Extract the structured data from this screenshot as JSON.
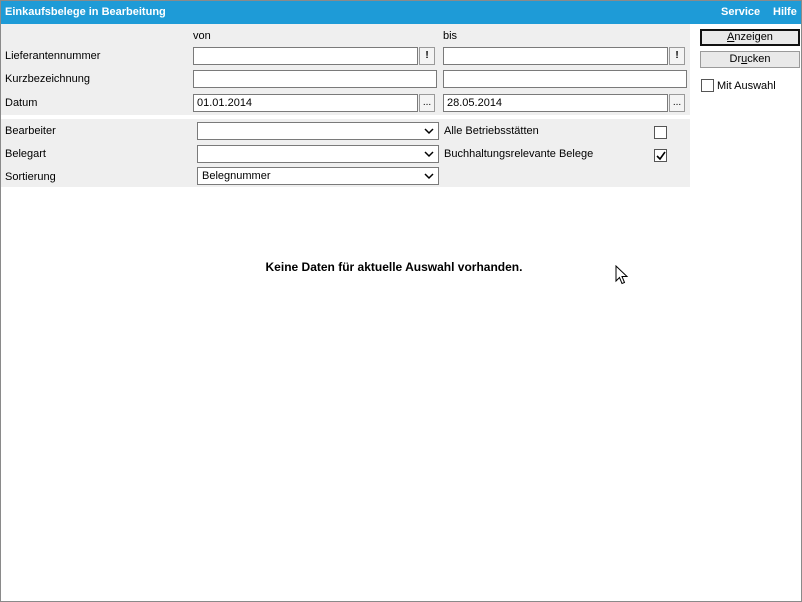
{
  "window": {
    "title": "Einkaufsbelege in Bearbeitung",
    "menu": [
      "Service",
      "Hilfe"
    ]
  },
  "columns": {
    "from": "von",
    "to": "bis"
  },
  "range_fields": {
    "supplier_number": {
      "label": "Lieferantennummer",
      "from_value": "",
      "to_value": "",
      "lookup_glyph": "!"
    },
    "short_name": {
      "label": "Kurzbezeichnung",
      "from_value": "",
      "to_value": ""
    },
    "date": {
      "label": "Datum",
      "from_value": "01.01.2014",
      "to_value": "28.05.2014",
      "picker_glyph": "..."
    }
  },
  "filters": {
    "editor": {
      "label": "Bearbeiter",
      "value": ""
    },
    "document_type": {
      "label": "Belegart",
      "value": ""
    },
    "sorting": {
      "label": "Sortierung",
      "value": "Belegnummer"
    },
    "all_sites": {
      "label": "Alle Betriebsstätten",
      "checked": false
    },
    "accounting_relevant": {
      "label": "Buchhaltungsrelevante Belege",
      "checked": true
    }
  },
  "actions": {
    "show": {
      "pre": "",
      "ul": "A",
      "post": "nzeigen"
    },
    "print": {
      "pre": "Dr",
      "ul": "u",
      "post": "cken"
    },
    "with_selection": {
      "label": "Mit Auswahl",
      "checked": false
    }
  },
  "result": {
    "empty_message": "Keine Daten für aktuelle Auswahl vorhanden."
  }
}
